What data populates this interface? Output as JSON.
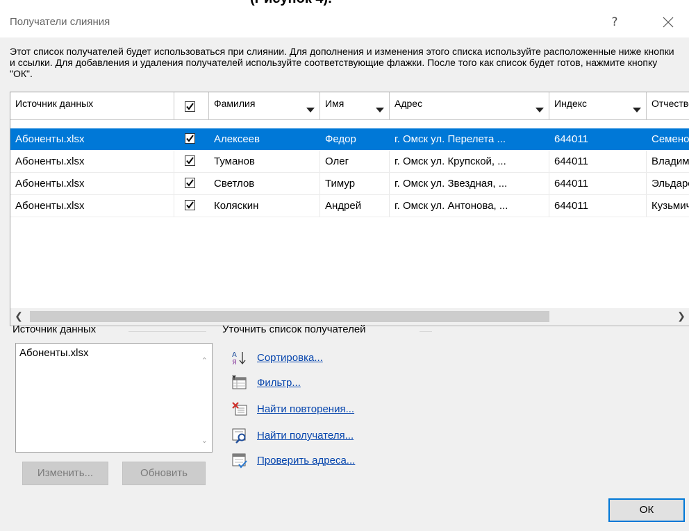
{
  "page_fragment_text": "(Рисунок 4).",
  "dialog": {
    "title": "Получатели слияния",
    "help_label": "?",
    "intro_text": "Этот список получателей будет использоваться при слиянии. Для дополнения и изменения этого списка используйте расположенные ниже кнопки и ссылки. Для добавления и удаления получателей используйте соответствующие флажки. После того как список будет готов, нажмите кнопку \"ОК\"."
  },
  "grid": {
    "columns": {
      "source": "Источник данных",
      "lastname": "Фамилия",
      "firstname": "Имя",
      "address": "Адрес",
      "index": "Индекс",
      "patronymic": "Отчество"
    },
    "rows": [
      {
        "source": "Абоненты.xlsx",
        "checked": true,
        "lastname": "Алексеев",
        "firstname": "Федор",
        "address": "г. Омск ул. Перелета ...",
        "index": "644011",
        "patronymic": "Семенович",
        "selected": true
      },
      {
        "source": "Абоненты.xlsx",
        "checked": true,
        "lastname": "Туманов",
        "firstname": "Олег",
        "address": "г. Омск ул. Крупской, ...",
        "index": "644011",
        "patronymic": "Владимирович",
        "selected": false
      },
      {
        "source": "Абоненты.xlsx",
        "checked": true,
        "lastname": "Светлов",
        "firstname": "Тимур",
        "address": "г. Омск ул. Звездная, ...",
        "index": "644011",
        "patronymic": "Эльдарович",
        "selected": false
      },
      {
        "source": "Абоненты.xlsx",
        "checked": true,
        "lastname": "Коляскин",
        "firstname": "Андрей",
        "address": "г. Омск ул. Антонова, ...",
        "index": "644011",
        "patronymic": "Кузьмич",
        "selected": false
      }
    ]
  },
  "data_source": {
    "title": "Источник данных",
    "items": [
      "Абоненты.xlsx"
    ],
    "edit_label": "Изменить...",
    "refresh_label": "Обновить"
  },
  "refine": {
    "title": "Уточнить список получателей",
    "links": [
      {
        "label": "Сортировка...",
        "icon": "sort-az-icon"
      },
      {
        "label": "Фильтр...",
        "icon": "filter-icon"
      },
      {
        "label": "Найти повторения...",
        "icon": "find-duplicates-icon"
      },
      {
        "label": "Найти получателя...",
        "icon": "find-recipient-icon"
      },
      {
        "label": "Проверить адреса...",
        "icon": "validate-addresses-icon"
      }
    ]
  },
  "ok_label": "ОК",
  "colors": {
    "selection": "#0078d7",
    "link": "#0645ad",
    "dialog_bg": "#f0f0f0"
  }
}
